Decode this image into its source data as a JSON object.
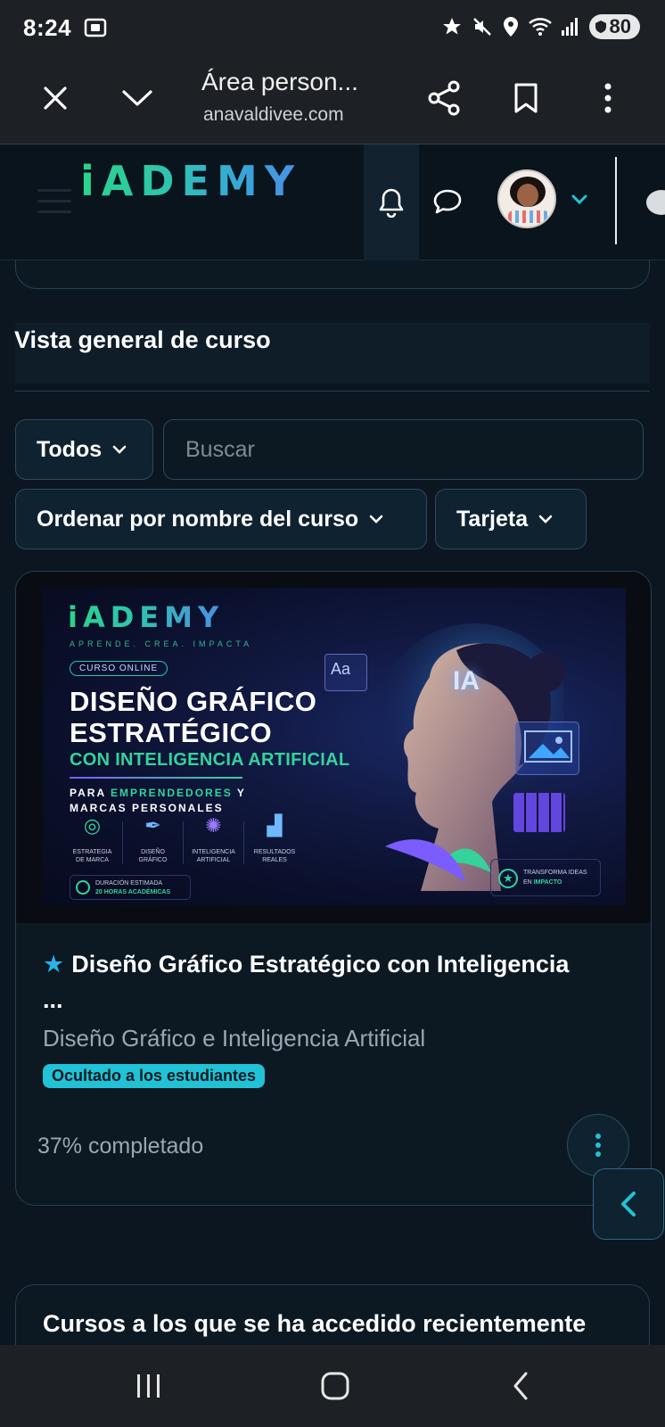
{
  "status_bar": {
    "time": "8:24",
    "battery": "80",
    "icons": [
      "screenshot-icon",
      "star-icon",
      "mute-icon",
      "location-icon",
      "wifi-icon",
      "signal-icon",
      "battery-icon"
    ]
  },
  "browser": {
    "title": "Área person...",
    "url": "anavaldivee.com",
    "buttons": [
      "close",
      "collapse",
      "share",
      "bookmark",
      "more"
    ]
  },
  "site_header": {
    "logo": "iADEMY",
    "icons": [
      "menu-icon",
      "bell-icon",
      "chat-icon",
      "avatar",
      "chevron-down-icon"
    ]
  },
  "overview": {
    "title": "Vista general de curso",
    "filter_label": "Todos",
    "search_placeholder": "Buscar",
    "sort_label": "Ordenar por nombre del curso",
    "view_label": "Tarjeta"
  },
  "course": {
    "banner": {
      "logo": "iADEMY",
      "tagline": "APRENDE. CREA. IMPACTA",
      "pill": "CURSO ONLINE",
      "heading_line1": "DISEÑO GRÁFICO",
      "heading_line2": "ESTRATÉGICO",
      "subheading": "CON INTELIGENCIA ARTIFICIAL",
      "for_prefix": "PARA",
      "for_highlight": "EMPRENDEDORES",
      "for_suffix": "Y",
      "for_line2": "MARCAS PERSONALES",
      "features": [
        {
          "line1": "ESTRATEGIA",
          "line2": "DE MARCA"
        },
        {
          "line1": "DISEÑO",
          "line2": "GRÁFICO"
        },
        {
          "line1": "INTELIGENCIA",
          "line2": "ARTIFICIAL"
        },
        {
          "line1": "RESULTADOS",
          "line2": "REALES"
        }
      ],
      "duration_label": "DURACIÓN ESTIMADA",
      "duration_value": "20 HORAS ACADÉMICAS",
      "ia_badge": "IA",
      "aa_label": "Aa",
      "transform_line1": "TRANSFORMA IDEAS",
      "transform_prefix": "EN",
      "transform_highlight": "IMPACTO"
    },
    "title": "Diseño Gráfico Estratégico con Inteligencia ...",
    "category": "Diseño Gráfico e Inteligencia Artificial",
    "badge": "Ocultado a los estudiantes",
    "progress_text": "37% completado",
    "progress_percent": 37
  },
  "recent": {
    "title": "Cursos a los que se ha accedido recientemente"
  },
  "colors": {
    "background": "#0b1620",
    "accent": "#22c2d6",
    "brand_green": "#2bd48a",
    "brand_blue": "#4a8fe6"
  }
}
